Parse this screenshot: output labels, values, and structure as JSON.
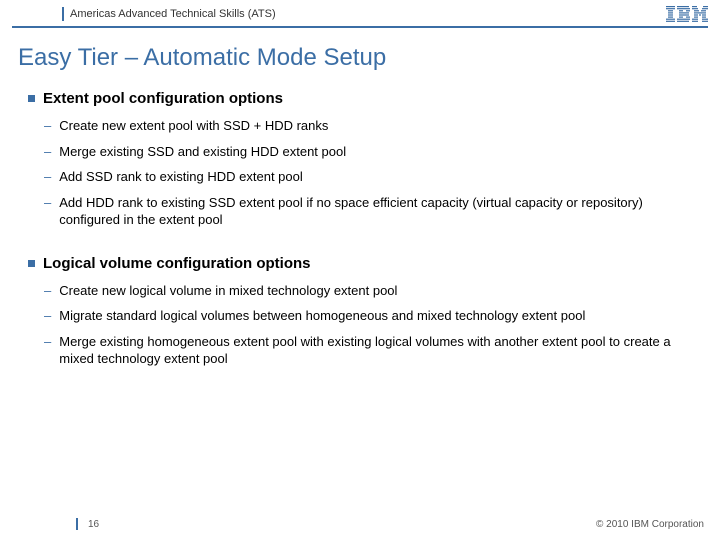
{
  "header": {
    "org": "Americas Advanced Technical Skills (ATS)",
    "logo_name": "ibm-logo"
  },
  "title": "Easy Tier – Automatic Mode Setup",
  "sections": [
    {
      "heading": "Extent pool configuration options",
      "items": [
        "Create new extent pool with SSD + HDD ranks",
        "Merge existing SSD and existing HDD extent pool",
        "Add SSD rank to existing HDD extent pool",
        "Add HDD rank to existing SSD extent pool if no space efficient capacity (virtual capacity or repository) configured in the extent pool"
      ]
    },
    {
      "heading": "Logical volume configuration options",
      "items": [
        "Create new logical volume in mixed technology extent pool",
        "Migrate standard logical volumes between homogeneous and mixed technology extent pool",
        "Merge existing homogeneous extent pool with existing logical volumes with another extent pool to create a mixed technology extent pool"
      ]
    }
  ],
  "footer": {
    "page": "16",
    "copyright": "© 2010 IBM Corporation"
  }
}
